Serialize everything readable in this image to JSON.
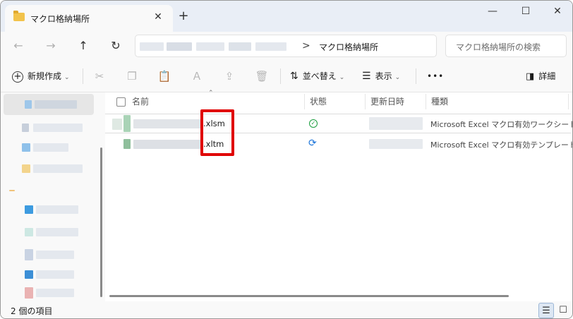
{
  "window": {
    "tab_title": "マクロ格納場所",
    "tab_close": "✕",
    "new_tab": "+",
    "minimize": "—",
    "maximize": "☐",
    "close": "✕"
  },
  "navigation": {
    "back": "←",
    "forward": "→",
    "up": "↑",
    "refresh": "↻",
    "breadcrumb_separator": ">",
    "current_folder": "マクロ格納場所",
    "search_placeholder": "マクロ格納場所の検索"
  },
  "toolbar": {
    "new_label": "新規作成",
    "sort_label": "並べ替え",
    "view_label": "表示",
    "more": "•••",
    "details_label": "詳細",
    "icons": [
      "new-icon",
      "cut-icon",
      "copy-icon",
      "paste-icon",
      "rename-icon",
      "share-icon",
      "delete-icon",
      "sort-icon",
      "view-icon",
      "more-icon",
      "details-pane-icon"
    ]
  },
  "columns": {
    "name": "名前",
    "status": "状態",
    "modified": "更新日時",
    "type": "種類"
  },
  "files": [
    {
      "name_visible": ".xlsm",
      "status_icon": "check-circle-icon",
      "type": "Microsoft Excel マクロ有効ワークシート"
    },
    {
      "name_visible": ".xltm",
      "status_icon": "sync-icon",
      "type": "Microsoft Excel マクロ有効テンプレート"
    }
  ],
  "status_bar": {
    "item_count": "2 個の項目"
  },
  "colors": {
    "highlight": "#e00000",
    "ok_status": "#1b9e3e",
    "sync_status": "#1a73d9",
    "folder": "#f2c34b"
  }
}
